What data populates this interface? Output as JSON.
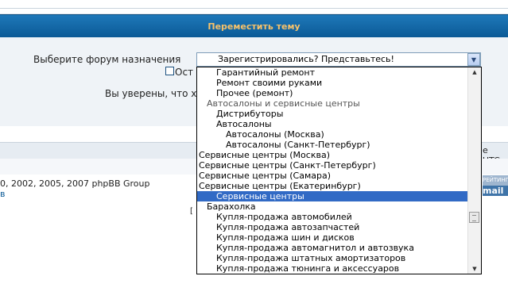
{
  "header": {
    "title": "Переместить тему"
  },
  "form": {
    "forum_label": "Выберите форум назначения",
    "selected_forum": "Зарегистрировались? Представьтесь!",
    "leave_label_partial": "Ост",
    "confirm_partial": "Вы уверены, что х"
  },
  "table": {
    "utc_partial": "е UTC"
  },
  "footer": {
    "copyright_partial": "0, 2002, 2005, 2007 phpBB Group",
    "link_partial": "в",
    "bracket": "[",
    "badge_top": "РЕЙТИНГ",
    "badge_bottom": "mail"
  },
  "dropdown": {
    "items": [
      {
        "label": "Гарантийный ремонт",
        "level": 2,
        "type": "option"
      },
      {
        "label": "Ремонт своими руками",
        "level": 2,
        "type": "option"
      },
      {
        "label": "Прочее (ремонт)",
        "level": 2,
        "type": "option"
      },
      {
        "label": "Автосалоны и сервисные центры",
        "level": 1,
        "type": "group"
      },
      {
        "label": "Дистрибуторы",
        "level": 2,
        "type": "option"
      },
      {
        "label": "Автосалоны",
        "level": 2,
        "type": "option"
      },
      {
        "label": "Автосалоны (Москва)",
        "level": 3,
        "type": "option"
      },
      {
        "label": "Автосалоны (Санкт-Петербург)",
        "level": 3,
        "type": "option"
      },
      {
        "label": "Сервисные центры (Москва)",
        "level": 0,
        "type": "option"
      },
      {
        "label": "Сервисные центры (Санкт-Петербург)",
        "level": 0,
        "type": "option"
      },
      {
        "label": "Сервисные центры (Самара)",
        "level": 0,
        "type": "option"
      },
      {
        "label": "Сервисные центры (Екатеринбург)",
        "level": 0,
        "type": "option"
      },
      {
        "label": "Сервисные центры",
        "level": 2,
        "type": "option",
        "selected": true
      },
      {
        "label": "Барахолка",
        "level": 1,
        "type": "option"
      },
      {
        "label": "Купля-продажа автомобилей",
        "level": 2,
        "type": "option"
      },
      {
        "label": "Купля-продажа автозапчастей",
        "level": 2,
        "type": "option"
      },
      {
        "label": "Купля-продажа шин и дисков",
        "level": 2,
        "type": "option"
      },
      {
        "label": "Купля-продажа автомагнитол и автозвука",
        "level": 2,
        "type": "option"
      },
      {
        "label": "Купля-продажа штатных амортизаторов",
        "level": 2,
        "type": "option"
      },
      {
        "label": "Купля-продажа тюнинга и аксессуаров",
        "level": 2,
        "type": "option"
      }
    ]
  },
  "colors": {
    "header_bg": "#0b5a96",
    "header_text": "#f7c26a",
    "selection": "#316ac5"
  }
}
